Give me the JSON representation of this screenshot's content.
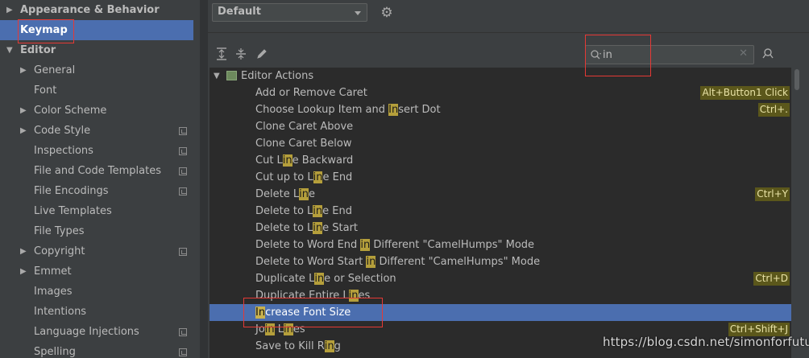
{
  "sidebar": {
    "items": [
      {
        "label": "Appearance & Behavior",
        "expandable": true,
        "expanded": false,
        "bold": true,
        "level": 0,
        "selected": false,
        "project_icon": false
      },
      {
        "label": "Keymap",
        "expandable": false,
        "bold": true,
        "level": 0,
        "selected": true,
        "project_icon": false
      },
      {
        "label": "Editor",
        "expandable": true,
        "expanded": true,
        "bold": true,
        "level": 0,
        "selected": false,
        "project_icon": false
      },
      {
        "label": "General",
        "expandable": true,
        "expanded": false,
        "bold": false,
        "level": 1,
        "selected": false,
        "project_icon": false
      },
      {
        "label": "Font",
        "expandable": false,
        "bold": false,
        "level": 1,
        "selected": false,
        "project_icon": false
      },
      {
        "label": "Color Scheme",
        "expandable": true,
        "expanded": false,
        "bold": false,
        "level": 1,
        "selected": false,
        "project_icon": false
      },
      {
        "label": "Code Style",
        "expandable": true,
        "expanded": false,
        "bold": false,
        "level": 1,
        "selected": false,
        "project_icon": true
      },
      {
        "label": "Inspections",
        "expandable": false,
        "bold": false,
        "level": 1,
        "selected": false,
        "project_icon": true
      },
      {
        "label": "File and Code Templates",
        "expandable": false,
        "bold": false,
        "level": 1,
        "selected": false,
        "project_icon": true
      },
      {
        "label": "File Encodings",
        "expandable": false,
        "bold": false,
        "level": 1,
        "selected": false,
        "project_icon": true
      },
      {
        "label": "Live Templates",
        "expandable": false,
        "bold": false,
        "level": 1,
        "selected": false,
        "project_icon": false
      },
      {
        "label": "File Types",
        "expandable": false,
        "bold": false,
        "level": 1,
        "selected": false,
        "project_icon": false
      },
      {
        "label": "Copyright",
        "expandable": true,
        "expanded": false,
        "bold": false,
        "level": 1,
        "selected": false,
        "project_icon": true
      },
      {
        "label": "Emmet",
        "expandable": true,
        "expanded": false,
        "bold": false,
        "level": 1,
        "selected": false,
        "project_icon": false
      },
      {
        "label": "Images",
        "expandable": false,
        "bold": false,
        "level": 1,
        "selected": false,
        "project_icon": false
      },
      {
        "label": "Intentions",
        "expandable": false,
        "bold": false,
        "level": 1,
        "selected": false,
        "project_icon": false
      },
      {
        "label": "Language Injections",
        "expandable": false,
        "bold": false,
        "level": 1,
        "selected": false,
        "project_icon": true
      },
      {
        "label": "Spelling",
        "expandable": false,
        "bold": false,
        "level": 1,
        "selected": false,
        "project_icon": true
      }
    ]
  },
  "keymap": {
    "scheme_value": "Default",
    "search": {
      "value": "in",
      "highlight": "in"
    },
    "toolbar_icons": [
      "expand-all-icon",
      "collapse-all-icon",
      "edit-shortcut-icon"
    ],
    "group": {
      "label": "Editor Actions"
    },
    "actions": [
      {
        "parts": [
          "Add or Remove Caret"
        ],
        "shortcut": "Alt+Button1 Click",
        "selected": false
      },
      {
        "parts": [
          "Choose Lookup Item and ",
          "In",
          "sert Dot"
        ],
        "shortcut": "Ctrl+.",
        "selected": false
      },
      {
        "parts": [
          "Clone Caret Above"
        ],
        "shortcut": "",
        "selected": false
      },
      {
        "parts": [
          "Clone Caret Below"
        ],
        "shortcut": "",
        "selected": false
      },
      {
        "parts": [
          "Cut L",
          "in",
          "e Backward"
        ],
        "shortcut": "",
        "selected": false
      },
      {
        "parts": [
          "Cut up to L",
          "in",
          "e End"
        ],
        "shortcut": "",
        "selected": false
      },
      {
        "parts": [
          "Delete L",
          "in",
          "e"
        ],
        "shortcut": "Ctrl+Y",
        "selected": false
      },
      {
        "parts": [
          "Delete to L",
          "in",
          "e End"
        ],
        "shortcut": "",
        "selected": false
      },
      {
        "parts": [
          "Delete to L",
          "in",
          "e Start"
        ],
        "shortcut": "",
        "selected": false
      },
      {
        "parts": [
          "Delete to Word End ",
          "in",
          " Different \"CamelHumps\" Mode"
        ],
        "shortcut": "",
        "selected": false
      },
      {
        "parts": [
          "Delete to Word Start ",
          "in",
          " Different \"CamelHumps\" Mode"
        ],
        "shortcut": "",
        "selected": false
      },
      {
        "parts": [
          "Duplicate L",
          "in",
          "e or Selection"
        ],
        "shortcut": "Ctrl+D",
        "selected": false
      },
      {
        "parts": [
          "Duplicate Entire L",
          "in",
          "es"
        ],
        "shortcut": "",
        "selected": false
      },
      {
        "parts": [
          "",
          "In",
          "crease Font Size"
        ],
        "shortcut": "",
        "selected": true
      },
      {
        "parts": [
          "Jo",
          "in",
          " L",
          "in",
          "es"
        ],
        "shortcut": "Ctrl+Shift+J",
        "selected": false
      },
      {
        "parts": [
          "Save to Kill R",
          "in",
          "g"
        ],
        "shortcut": "",
        "selected": false
      }
    ]
  },
  "watermark": "https://blog.csdn.net/simonforfuture",
  "colors": {
    "selection": "#4b6eaf",
    "match_highlight": "#b59f3b",
    "annotation": "#e53935"
  }
}
